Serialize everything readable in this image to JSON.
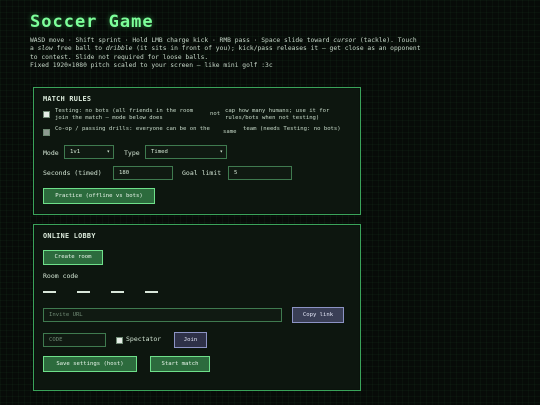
{
  "title": "Soccer Game",
  "help": {
    "line1_a": "WASD move · Shift sprint · Hold LMB charge kick · RMB pass · Space slide toward ",
    "line1_em": "cursor",
    "line1_b": " (tackle). Touch",
    "line2_a": "a ",
    "line2_em1": "slow",
    "line2_b": " free ball to ",
    "line2_em2": "dribble",
    "line2_c": " (it sits in front of you); kick/pass releases it — get close as an opponent",
    "line3": "to contest. Slide not required for loose balls.",
    "line4": "Fixed 1920×1080 pitch scaled to your screen — like mini golf :3c"
  },
  "match_rules": {
    "title": "MATCH RULES",
    "testing_label_a": "Testing: no bots (all friends in the room join the match — mode below does",
    "testing_label_not": "not",
    "testing_label_b": "cap how many humans; use it for rules/bots when not testing)",
    "coop_label_a": "Co-op / passing drills: everyone can be on the",
    "coop_label_same": "same",
    "coop_label_b": "team (needs Testing: no bots)",
    "mode_label": "Mode",
    "mode_value": "1v1",
    "type_label": "Type",
    "type_value": "Timed",
    "seconds_label": "Seconds (timed)",
    "seconds_value": "180",
    "goal_limit_label": "Goal limit",
    "goal_limit_value": "5",
    "practice_button": "Practice (offline vs bots)"
  },
  "lobby": {
    "title": "ONLINE LOBBY",
    "create_room_button": "Create room",
    "room_code_label": "Room code",
    "invite_url_placeholder": "Invite URL",
    "copy_link_button": "Copy link",
    "code_placeholder": "CODE",
    "spectator_label": "Spectator",
    "join_button": "Join",
    "save_settings_button": "Save settings (host)",
    "start_match_button": "Start match"
  }
}
